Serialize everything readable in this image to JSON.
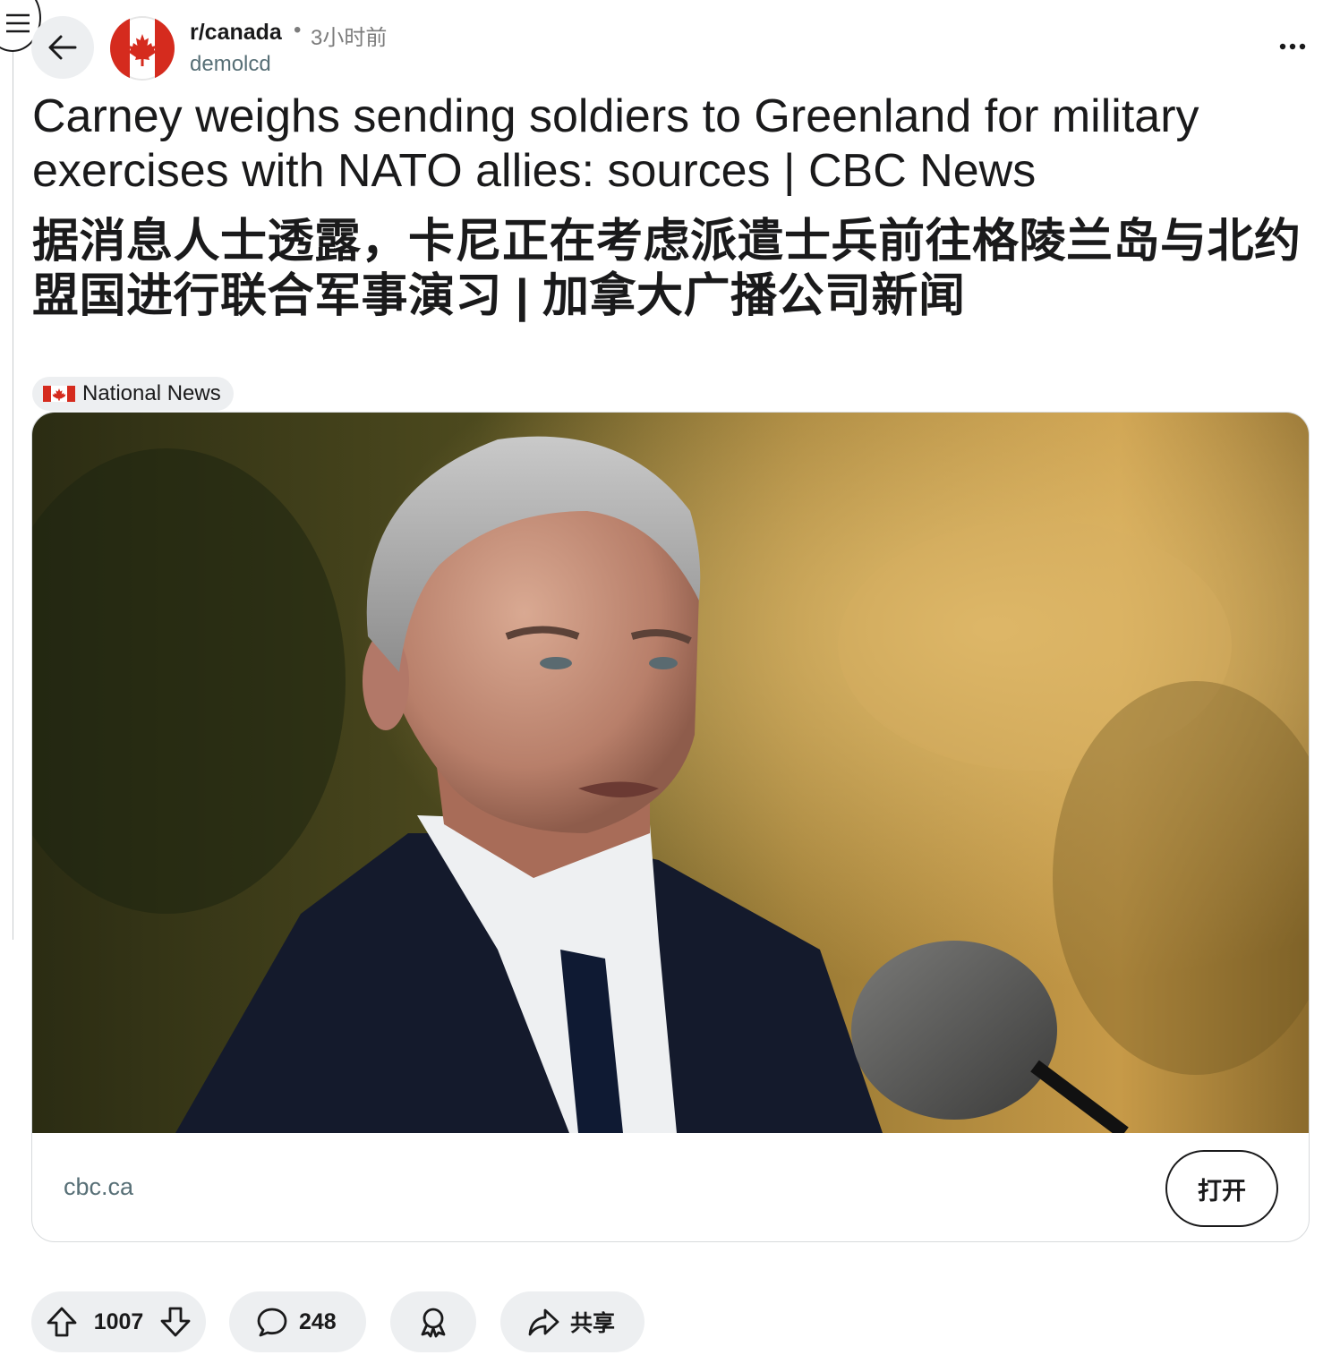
{
  "header": {
    "subreddit": "r/canada",
    "separator": "•",
    "time_ago": "3小时前",
    "author": "demolcd",
    "avatar_icon": "canada-flag-icon",
    "back_icon": "arrow-left-icon",
    "menu_icon": "hamburger-icon",
    "more_icon": "ellipsis-icon"
  },
  "post": {
    "title_en": "Carney weighs sending soldiers to Greenland for military exercises with NATO allies: sources | CBC News",
    "title_zh": "据消息人士透露，卡尼正在考虑派遣士兵前往格陵兰岛与北约盟国进行联合军事演习 | 加拿大广播公司新闻",
    "flair": {
      "icon": "canada-flag-icon",
      "label": "National News"
    }
  },
  "link_card": {
    "image_alt": "Photo of a grey-haired man in a dark suit speaking at a microphone outdoors",
    "domain": "cbc.ca",
    "open_label": "打开"
  },
  "actions": {
    "vote_count": "1007",
    "comment_count": "248",
    "share_label": "共享",
    "icons": [
      "upvote-icon",
      "downvote-icon",
      "comment-icon",
      "award-icon",
      "share-icon"
    ]
  },
  "colors": {
    "text": "#1a1a1b",
    "muted": "#576f76",
    "pill_bg": "#edeff1",
    "card_border": "#d7dadc",
    "canada_red": "#d52b1e"
  }
}
